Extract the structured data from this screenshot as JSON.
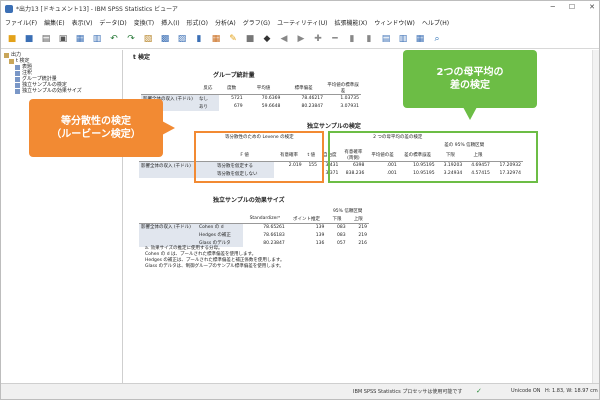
{
  "window": {
    "title": "*出力13 [ドキュメント13] - IBM SPSS Statistics ビューア"
  },
  "menu": [
    "ファイル(F)",
    "編集(E)",
    "表示(V)",
    "データ(D)",
    "変換(T)",
    "挿入(I)",
    "形式(O)",
    "分析(A)",
    "グラフ(G)",
    "ユーティリティ(U)",
    "拡張機能(X)",
    "ウィンドウ(W)",
    "ヘルプ(H)"
  ],
  "nav": {
    "items": [
      "出力",
      "t 検定",
      "表題",
      "注釈",
      "グループ統計量",
      "独立サンプルの検定",
      "独立サンプルの効果サイズ"
    ]
  },
  "output": {
    "heading": "t 検定",
    "group_stats": {
      "title": "グループ統計量",
      "headers": [
        "反応",
        "度数",
        "平均値",
        "標準偏差",
        "平均値の標準誤差"
      ],
      "row_label": "影響全体の収入 (千ドル)",
      "rows": [
        [
          "なし",
          "5721",
          "70.6369",
          "78.46217",
          "1.03735"
        ],
        [
          "あり",
          "679",
          "59.6648",
          "80.23847",
          "3.07931"
        ]
      ]
    },
    "ind_test": {
      "title": "独立サンプルの検定",
      "levene_header": "等分散性のための Levene の検定",
      "ttest_header": "2 つの母平均の差の検定",
      "ci_header": "差の 95% 信頼区間",
      "subheaders": [
        "F 値",
        "有意確率",
        "t 値",
        "自由度",
        "有意確率 (両側)",
        "平均値の差",
        "差の標準誤差",
        "下限",
        "上限"
      ],
      "row_label": "影響全体の収入 (千ドル)",
      "rows": [
        {
          "label": "等分散を仮定する",
          "vals": [
            "2.019",
            "155",
            "3.431",
            "6398",
            ".001",
            "10.95195",
            "3.19203",
            "4.69457",
            "17.20932"
          ]
        },
        {
          "label": "等分散を仮定しない",
          "vals": [
            "",
            "",
            "3.371",
            "838.236",
            ".001",
            "10.95195",
            "3.24934",
            "4.57415",
            "17.32974"
          ]
        }
      ]
    },
    "effect": {
      "title": "独立サンプルの効果サイズ",
      "ci_header": "95% 信頼区間",
      "headers": [
        "Standardizerᵃ",
        "ポイント推定",
        "下限",
        "上限"
      ],
      "row_label": "影響全体の収入 (千ドル)",
      "rows": [
        {
          "label": "Cohen の d",
          "vals": [
            "78.65261",
            "139",
            "083",
            "219"
          ]
        },
        {
          "label": "Hedges の補正",
          "vals": [
            "78.66183",
            "139",
            "083",
            "219"
          ]
        },
        {
          "label": "Glass のデルタ",
          "vals": [
            "80.23847",
            "136",
            "057",
            "216"
          ]
        }
      ],
      "notes": [
        "a. 効果サイズの推定に使用する分母。",
        "Cohen の d は、プールされた標準偏差を使用します。",
        "Hedges の補正は、プールされた標準偏差と補正係数を使用します。",
        "Glass のデルタは、制御グループのサンプル標準偏差を使用します。"
      ]
    }
  },
  "callouts": {
    "orange_line1": "等分散性の検定",
    "orange_line2": "（ルービーン検定）",
    "green_line1": "2つの母平均の",
    "green_line2": "差の検定"
  },
  "status": {
    "processor": "IBM SPSS Statistics プロセッサは使用可能です",
    "unicode": "Unicode ON",
    "dims": "H: 1.83, W: 18.97 cm"
  },
  "colors": {
    "orange": "#f28a33",
    "green": "#6cbd45",
    "header_tint": "#e1e6ee"
  }
}
